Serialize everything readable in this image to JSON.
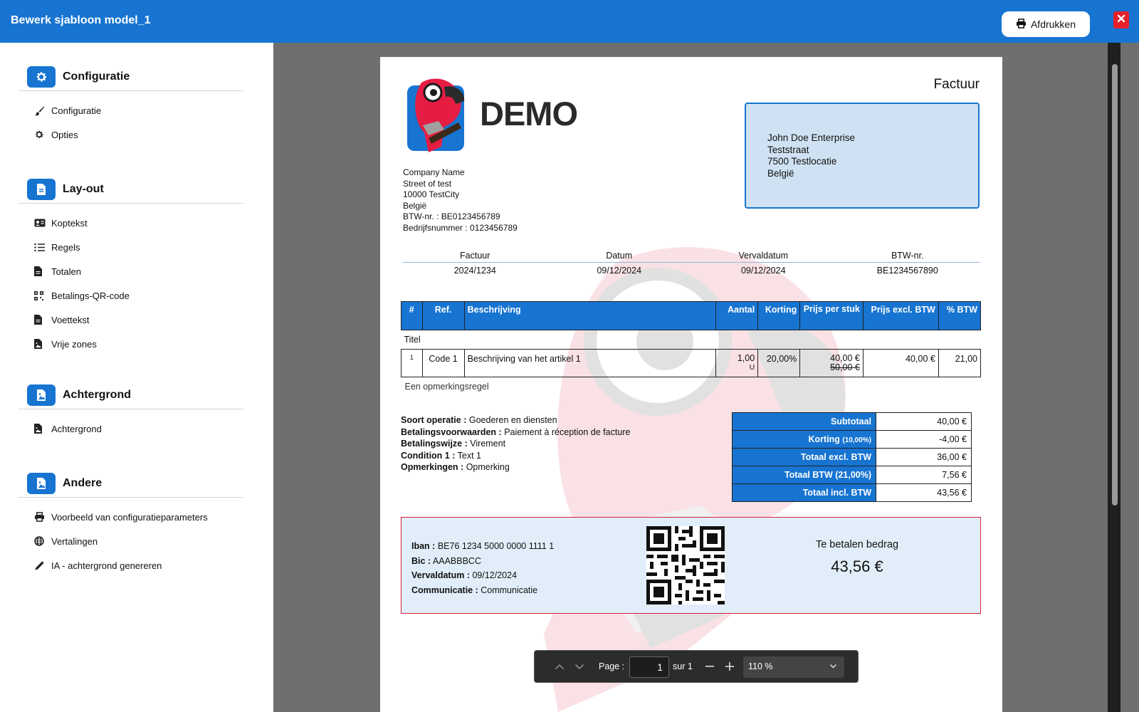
{
  "window": {
    "title": "Bewerk sjabloon model_1",
    "print_label": "Afdrukken"
  },
  "sidebar": {
    "sections": [
      {
        "title": "Configuratie",
        "icon": "gear-icon",
        "items": [
          {
            "label": "Configuratie",
            "icon": "brush-icon"
          },
          {
            "label": "Opties",
            "icon": "gear-icon"
          }
        ]
      },
      {
        "title": "Lay-out",
        "icon": "document-icon",
        "items": [
          {
            "label": "Koptekst",
            "icon": "id-card-icon"
          },
          {
            "label": "Regels",
            "icon": "list-icon"
          },
          {
            "label": "Totalen",
            "icon": "file-icon"
          },
          {
            "label": "Betalings-QR-code",
            "icon": "qr-icon"
          },
          {
            "label": "Voettekst",
            "icon": "file-icon"
          },
          {
            "label": "Vrije zones",
            "icon": "file-image-icon"
          }
        ]
      },
      {
        "title": "Achtergrond",
        "icon": "image-icon",
        "items": [
          {
            "label": "Achtergrond",
            "icon": "file-image-icon"
          }
        ]
      },
      {
        "title": "Andere",
        "icon": "image-icon",
        "items": [
          {
            "label": "Voorbeeld van configuratieparameters",
            "icon": "printer-icon"
          },
          {
            "label": "Vertalingen",
            "icon": "globe-icon"
          },
          {
            "label": "IA - achtergrond genereren",
            "icon": "pencil-icon"
          }
        ]
      }
    ]
  },
  "invoice": {
    "brand": "DEMO",
    "doc_title": "Factuur",
    "client": [
      "John Doe Enterprise",
      "Teststraat",
      "7500 Testlocatie",
      "België"
    ],
    "company": {
      "name": "Company Name",
      "street": "Street of test",
      "city": "10000 TestCity",
      "country": "België",
      "vat_label": "BTW-nr. :",
      "vat": "BE0123456789",
      "reg_label": "Bedrijfsnummer :",
      "reg": "0123456789"
    },
    "meta": {
      "headers": [
        "Factuur",
        "Datum",
        "Vervaldatum",
        "BTW-nr."
      ],
      "values": [
        "2024/1234",
        "09/12/2024",
        "09/12/2024",
        "BE1234567890"
      ]
    },
    "lines": {
      "headers": [
        "#",
        "Ref.",
        "Beschrijving",
        "Aantal",
        "Korting",
        "Prijs per stuk",
        "Prijs excl. BTW",
        "% BTW"
      ],
      "title_row": "Titel",
      "rows": [
        {
          "num": "1",
          "ref": "Code 1",
          "desc": "Beschrijving van het artikel 1",
          "qty": "1,00",
          "unit": "U",
          "discount": "20,00%",
          "price": "40,00 €",
          "old_price": "50,00 €",
          "total": "40,00 €",
          "vat": "21,00"
        }
      ],
      "remark": "Een opmerkingsregel"
    },
    "conditions": [
      {
        "label": "Soort operatie :",
        "value": "Goederen en diensten"
      },
      {
        "label": "Betalingsvoorwaarden :",
        "value": "Paiement à réception de facture"
      },
      {
        "label": "Betalingswijze :",
        "value": "Virement"
      },
      {
        "label": "Condition 1 :",
        "value": "Text 1"
      },
      {
        "label": "Opmerkingen :",
        "value": "Opmerking"
      }
    ],
    "totals": [
      {
        "label": "Subtotaal",
        "small": "",
        "value": "40,00 €"
      },
      {
        "label": "Korting",
        "small": "(10,00%)",
        "value": "-4,00 €"
      },
      {
        "label": "Totaal excl. BTW",
        "small": "",
        "value": "36,00 €"
      },
      {
        "label": "Totaal BTW (21,00%)",
        "small": "",
        "value": "7,56 €"
      },
      {
        "label": "Totaal incl. BTW",
        "small": "",
        "value": "43,56 €"
      }
    ],
    "payment": {
      "iban_label": "Iban :",
      "iban": "BE76 1234 5000 0000 1111 1",
      "bic_label": "Bic :",
      "bic": "AAABBBCC",
      "due_label_line": "Vervaldatum :",
      "due_date": "09/12/2024",
      "comm_label": "Communicatie :",
      "comm": "Communicatie",
      "amount_label": "Te betalen bedrag",
      "amount": "43,56 €"
    }
  },
  "pdf_toolbar": {
    "page_label": "Page :",
    "page_value": "1",
    "of_label": "sur 1",
    "zoom": "110 %"
  },
  "colors": {
    "accent": "#1774d1",
    "danger": "#e5202a",
    "client_bg": "#cfe2f3",
    "pay_bg": "#e1eef9"
  }
}
